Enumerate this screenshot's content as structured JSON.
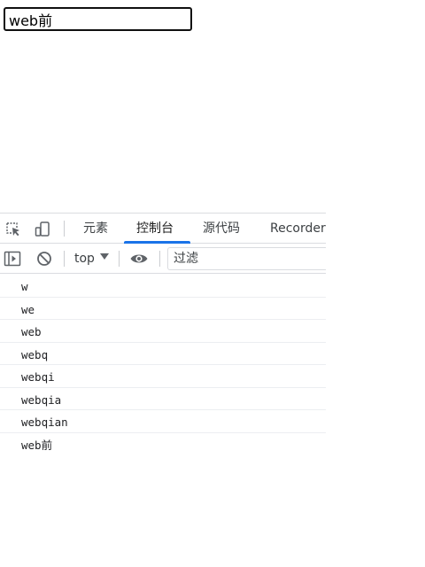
{
  "page": {
    "input_value": "web前"
  },
  "devtools": {
    "tabs": [
      {
        "label": "元素",
        "active": false
      },
      {
        "label": "控制台",
        "active": true
      },
      {
        "label": "源代码",
        "active": false
      },
      {
        "label": "Recorder",
        "active": false
      }
    ],
    "toolbar": {
      "context": "top",
      "filter_placeholder": "过滤"
    },
    "icons": [
      "inspect-icon",
      "device-toolbar-icon",
      "sidebar-toggle-icon",
      "clear-console-icon",
      "live-expression-eye-icon"
    ],
    "accent_color": "#1a73e8",
    "console_messages": [
      "w",
      "we",
      "web",
      "webq",
      "webqi",
      "webqia",
      "webqian",
      "web前"
    ]
  }
}
